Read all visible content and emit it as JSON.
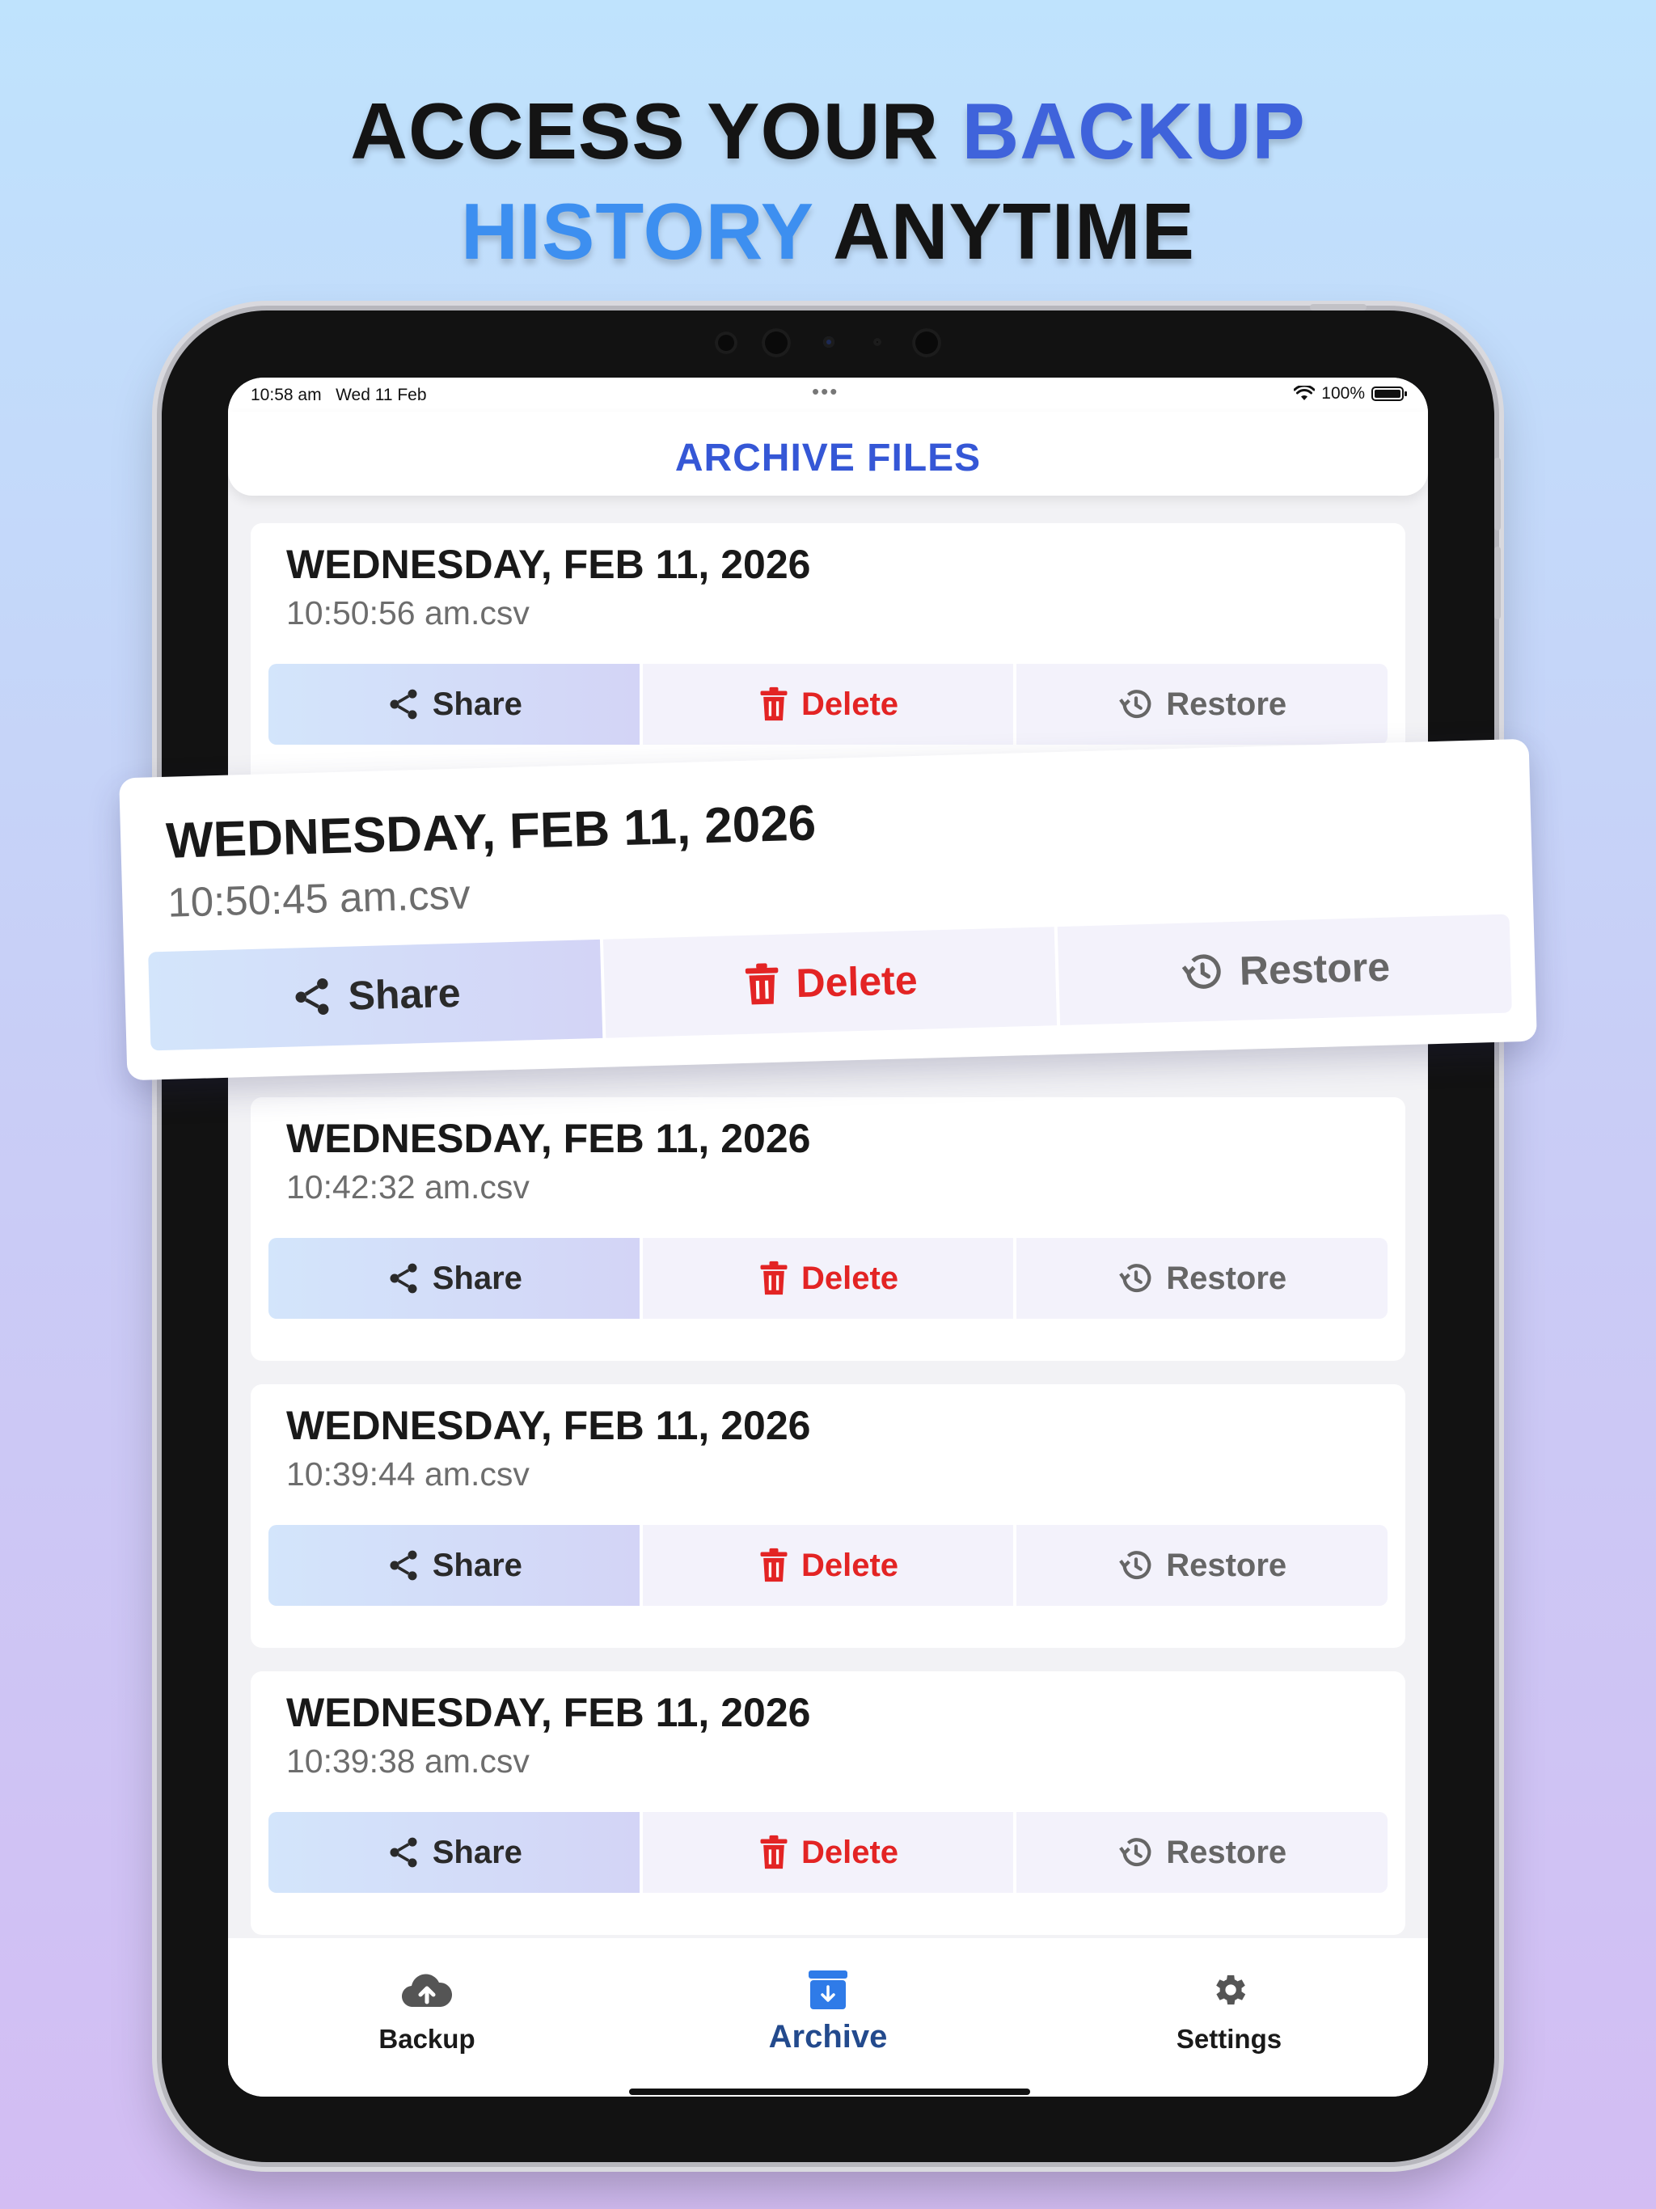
{
  "headline": {
    "line1_a": "ACCESS YOUR ",
    "line1_b": "BACKUP",
    "line2_a": "HISTORY",
    "line2_b": " ANYTIME"
  },
  "status_bar": {
    "time": "10:58 am",
    "date": "Wed 11 Feb",
    "dots": "•••",
    "battery": "100%"
  },
  "nav": {
    "title": "ARCHIVE FILES"
  },
  "actions": {
    "share": "Share",
    "delete": "Delete",
    "restore": "Restore"
  },
  "files": [
    {
      "date": "WEDNESDAY, FEB 11, 2026",
      "file": "10:50:56 am.csv"
    },
    {
      "date": "WEDNESDAY, FEB 11, 2026",
      "file": "10:42:32 am.csv"
    },
    {
      "date": "WEDNESDAY, FEB 11, 2026",
      "file": "10:39:44 am.csv"
    },
    {
      "date": "WEDNESDAY, FEB 11, 2026",
      "file": "10:39:38 am.csv"
    }
  ],
  "highlighted": {
    "date": "WEDNESDAY, FEB 11, 2026",
    "file": "10:50:45 am.csv"
  },
  "tabs": [
    {
      "label": "Backup",
      "icon": "cloud-upload-icon"
    },
    {
      "label": "Archive",
      "icon": "archive-icon"
    },
    {
      "label": "Settings",
      "icon": "gear-icon"
    }
  ],
  "colors": {
    "accent_blue": "#3557d6",
    "delete_red": "#e32424",
    "active_tab": "#234a8d"
  }
}
